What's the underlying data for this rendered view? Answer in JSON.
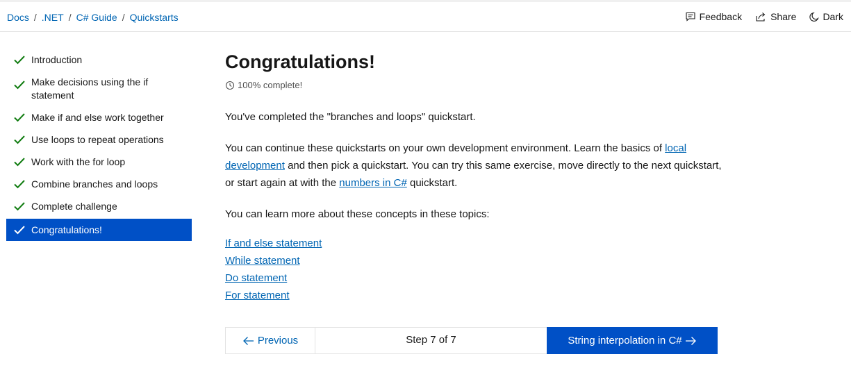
{
  "breadcrumb": {
    "items": [
      "Docs",
      ".NET",
      "C# Guide",
      "Quickstarts"
    ],
    "separator": "/"
  },
  "header_actions": {
    "feedback": "Feedback",
    "share": "Share",
    "theme": "Dark"
  },
  "sidebar": {
    "steps": [
      {
        "label": "Introduction",
        "completed": true
      },
      {
        "label": "Make decisions using the if statement",
        "completed": true
      },
      {
        "label": "Make if and else work together",
        "completed": true
      },
      {
        "label": "Use loops to repeat operations",
        "completed": true
      },
      {
        "label": "Work with the for loop",
        "completed": true
      },
      {
        "label": "Combine branches and loops",
        "completed": true
      },
      {
        "label": "Complete challenge",
        "completed": true
      },
      {
        "label": "Congratulations!",
        "completed": true,
        "active": true
      }
    ]
  },
  "main": {
    "title": "Congratulations!",
    "progress_text": "100% complete!",
    "paragraph1": "You've completed the \"branches and loops\" quickstart.",
    "paragraph2": {
      "part1": "You can continue these quickstarts on your own development environment. Learn the basics of ",
      "link1": "local development",
      "part2": " and then pick a quickstart. You can try this same exercise, move directly to the next quickstart, or start again at with the ",
      "link2": "numbers in C#",
      "part3": " quickstart."
    },
    "paragraph3": "You can learn more about these concepts in these topics:",
    "topic_links": [
      "If and else statement",
      "While statement",
      "Do statement",
      "For statement"
    ]
  },
  "pager": {
    "previous": "Previous",
    "step_counter": "Step 7 of 7",
    "next": "String interpolation in C#"
  },
  "colors": {
    "accent": "#0050c6",
    "link": "#0065b3",
    "check": "#107c10"
  }
}
